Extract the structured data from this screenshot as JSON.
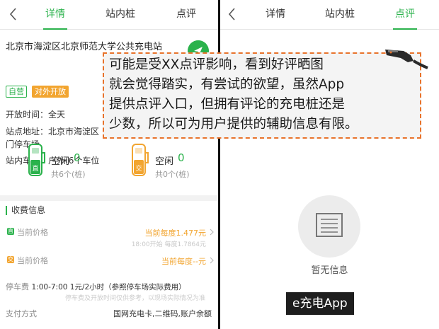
{
  "left_screen": {
    "tabs": [
      {
        "label": "详情",
        "active": true
      },
      {
        "label": "站内桩",
        "active": false
      },
      {
        "label": "点评",
        "active": false
      }
    ],
    "station_name": "北京市海淀区北京师范大学公共充电站",
    "tags": {
      "ziying": "自营",
      "open": "对外开放"
    },
    "open_time": {
      "label": "开放时间：",
      "value": "全天"
    },
    "address": {
      "label": "站点地址：",
      "value": "北京市海淀区",
      "line2": "门停车场"
    },
    "parking": {
      "label": "站内车位：",
      "value": "户外(6个车位"
    },
    "piles": [
      {
        "icon_text": "直",
        "status": "空闲",
        "count": "0",
        "total": "共6个(桩)",
        "color": "#2bb24c"
      },
      {
        "icon_text": "交",
        "status": "空闲",
        "count": "0",
        "total": "共0个(桩)",
        "color": "#f2a530"
      }
    ],
    "fee_section": {
      "title": "收费信息",
      "price1": {
        "icon": "直",
        "label": "当前价格",
        "value": "当前每度1.477元",
        "sub": "18:00开始 每度1.7864元"
      },
      "price2": {
        "icon": "交",
        "label": "当前价格",
        "value": "当前每度--元"
      },
      "parking_fee": {
        "label": "停车费",
        "value": "1:00-7:00 1元/2小时（参照停车场实际费用）",
        "sub": "停车费及开放时间仅供参考，以现场实际情况为准"
      },
      "payment": {
        "label": "支付方式",
        "value": "国网充电卡,二维码,账户余额"
      }
    }
  },
  "right_screen": {
    "tabs": [
      {
        "label": "详情",
        "active": false
      },
      {
        "label": "站内桩",
        "active": false
      },
      {
        "label": "点评",
        "active": true
      }
    ],
    "empty_text": "暂无信息"
  },
  "overlay_caption": {
    "lines": [
      "可能是受XX点评影响，看到好评晒图",
      "就会觉得踏实，有尝试的欲望，虽然App",
      "提供点评入口，但拥有评论的充电桩还是",
      "少数，所以可为用户提供的辅助信息有限。"
    ]
  },
  "watermark": "e充电App",
  "colors": {
    "accent_green": "#2bb24c",
    "accent_orange": "#f2a530",
    "caption_border": "#e8732c"
  },
  "icons": [
    "back-chevron-icon",
    "navigation-icon",
    "dc-charger-icon",
    "ac-charger-icon",
    "chevron-right-icon",
    "empty-document-icon",
    "charging-plug-icon"
  ]
}
